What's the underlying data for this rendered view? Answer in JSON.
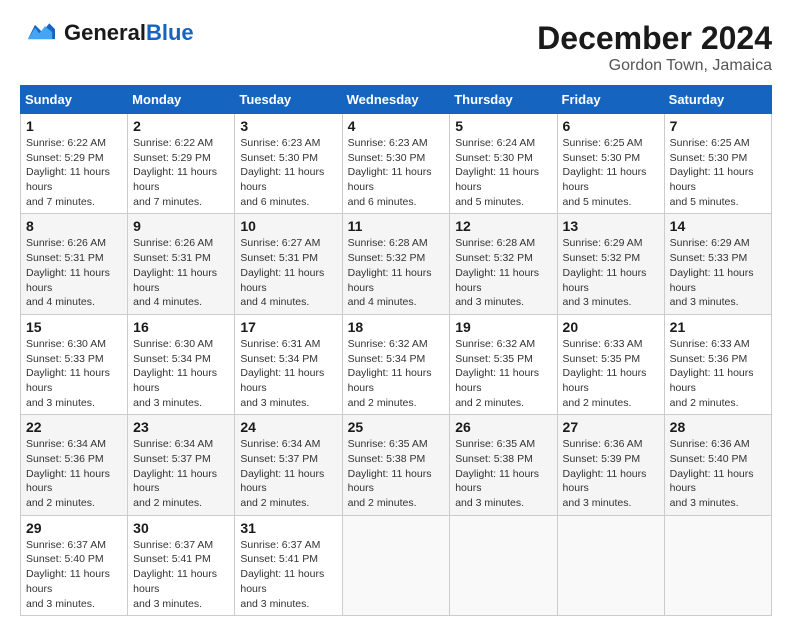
{
  "header": {
    "logo_general": "General",
    "logo_blue": "Blue",
    "month_title": "December 2024",
    "location": "Gordon Town, Jamaica"
  },
  "weekdays": [
    "Sunday",
    "Monday",
    "Tuesday",
    "Wednesday",
    "Thursday",
    "Friday",
    "Saturday"
  ],
  "weeks": [
    [
      {
        "day": "1",
        "sunrise": "6:22 AM",
        "sunset": "5:29 PM",
        "daylight": "11 hours and 7 minutes."
      },
      {
        "day": "2",
        "sunrise": "6:22 AM",
        "sunset": "5:29 PM",
        "daylight": "11 hours and 7 minutes."
      },
      {
        "day": "3",
        "sunrise": "6:23 AM",
        "sunset": "5:30 PM",
        "daylight": "11 hours and 6 minutes."
      },
      {
        "day": "4",
        "sunrise": "6:23 AM",
        "sunset": "5:30 PM",
        "daylight": "11 hours and 6 minutes."
      },
      {
        "day": "5",
        "sunrise": "6:24 AM",
        "sunset": "5:30 PM",
        "daylight": "11 hours and 5 minutes."
      },
      {
        "day": "6",
        "sunrise": "6:25 AM",
        "sunset": "5:30 PM",
        "daylight": "11 hours and 5 minutes."
      },
      {
        "day": "7",
        "sunrise": "6:25 AM",
        "sunset": "5:30 PM",
        "daylight": "11 hours and 5 minutes."
      }
    ],
    [
      {
        "day": "8",
        "sunrise": "6:26 AM",
        "sunset": "5:31 PM",
        "daylight": "11 hours and 4 minutes."
      },
      {
        "day": "9",
        "sunrise": "6:26 AM",
        "sunset": "5:31 PM",
        "daylight": "11 hours and 4 minutes."
      },
      {
        "day": "10",
        "sunrise": "6:27 AM",
        "sunset": "5:31 PM",
        "daylight": "11 hours and 4 minutes."
      },
      {
        "day": "11",
        "sunrise": "6:28 AM",
        "sunset": "5:32 PM",
        "daylight": "11 hours and 4 minutes."
      },
      {
        "day": "12",
        "sunrise": "6:28 AM",
        "sunset": "5:32 PM",
        "daylight": "11 hours and 3 minutes."
      },
      {
        "day": "13",
        "sunrise": "6:29 AM",
        "sunset": "5:32 PM",
        "daylight": "11 hours and 3 minutes."
      },
      {
        "day": "14",
        "sunrise": "6:29 AM",
        "sunset": "5:33 PM",
        "daylight": "11 hours and 3 minutes."
      }
    ],
    [
      {
        "day": "15",
        "sunrise": "6:30 AM",
        "sunset": "5:33 PM",
        "daylight": "11 hours and 3 minutes."
      },
      {
        "day": "16",
        "sunrise": "6:30 AM",
        "sunset": "5:34 PM",
        "daylight": "11 hours and 3 minutes."
      },
      {
        "day": "17",
        "sunrise": "6:31 AM",
        "sunset": "5:34 PM",
        "daylight": "11 hours and 3 minutes."
      },
      {
        "day": "18",
        "sunrise": "6:32 AM",
        "sunset": "5:34 PM",
        "daylight": "11 hours and 2 minutes."
      },
      {
        "day": "19",
        "sunrise": "6:32 AM",
        "sunset": "5:35 PM",
        "daylight": "11 hours and 2 minutes."
      },
      {
        "day": "20",
        "sunrise": "6:33 AM",
        "sunset": "5:35 PM",
        "daylight": "11 hours and 2 minutes."
      },
      {
        "day": "21",
        "sunrise": "6:33 AM",
        "sunset": "5:36 PM",
        "daylight": "11 hours and 2 minutes."
      }
    ],
    [
      {
        "day": "22",
        "sunrise": "6:34 AM",
        "sunset": "5:36 PM",
        "daylight": "11 hours and 2 minutes."
      },
      {
        "day": "23",
        "sunrise": "6:34 AM",
        "sunset": "5:37 PM",
        "daylight": "11 hours and 2 minutes."
      },
      {
        "day": "24",
        "sunrise": "6:34 AM",
        "sunset": "5:37 PM",
        "daylight": "11 hours and 2 minutes."
      },
      {
        "day": "25",
        "sunrise": "6:35 AM",
        "sunset": "5:38 PM",
        "daylight": "11 hours and 2 minutes."
      },
      {
        "day": "26",
        "sunrise": "6:35 AM",
        "sunset": "5:38 PM",
        "daylight": "11 hours and 3 minutes."
      },
      {
        "day": "27",
        "sunrise": "6:36 AM",
        "sunset": "5:39 PM",
        "daylight": "11 hours and 3 minutes."
      },
      {
        "day": "28",
        "sunrise": "6:36 AM",
        "sunset": "5:40 PM",
        "daylight": "11 hours and 3 minutes."
      }
    ],
    [
      {
        "day": "29",
        "sunrise": "6:37 AM",
        "sunset": "5:40 PM",
        "daylight": "11 hours and 3 minutes."
      },
      {
        "day": "30",
        "sunrise": "6:37 AM",
        "sunset": "5:41 PM",
        "daylight": "11 hours and 3 minutes."
      },
      {
        "day": "31",
        "sunrise": "6:37 AM",
        "sunset": "5:41 PM",
        "daylight": "11 hours and 3 minutes."
      },
      null,
      null,
      null,
      null
    ]
  ],
  "labels": {
    "sunrise": "Sunrise:",
    "sunset": "Sunset:",
    "daylight": "Daylight:"
  }
}
